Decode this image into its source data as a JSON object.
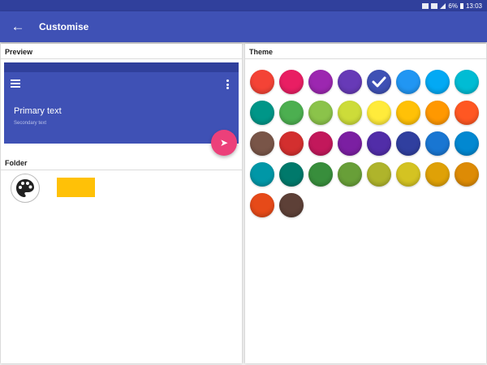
{
  "status_bar": {
    "battery": "6%",
    "time": "13:03"
  },
  "app_bar": {
    "title": "Customise",
    "back_icon": "arrow-back-icon"
  },
  "preview": {
    "section_title": "Preview",
    "primary_text": "Primary text",
    "secondary_text": "Secondary text",
    "bar_color": "#3f51b5",
    "fab_color": "#ec407a"
  },
  "folder": {
    "section_title": "Folder",
    "icon": "palette-icon",
    "color": "#ffc107"
  },
  "theme": {
    "section_title": "Theme",
    "selected_index": 4,
    "colors": [
      "#f44336",
      "#e91e63",
      "#9c27b0",
      "#673ab7",
      "#3f51b5",
      "#2196f3",
      "#03a9f4",
      "#00bcd4",
      "#009688",
      "#4caf50",
      "#8bc34a",
      "#cddc39",
      "#ffeb3b",
      "#ffc107",
      "#ff9800",
      "#ff5722",
      "#795548",
      "#d32f2f",
      "#c2185b",
      "#7b1fa2",
      "#512da8",
      "#303f9f",
      "#1976d2",
      "#0288d1",
      "#0097a7",
      "#00796b",
      "#388e3c",
      "#689f38",
      "#afb42b",
      "#d4c322",
      "#dfa107",
      "#dd8b05",
      "#e64a19",
      "#5d4037"
    ]
  }
}
